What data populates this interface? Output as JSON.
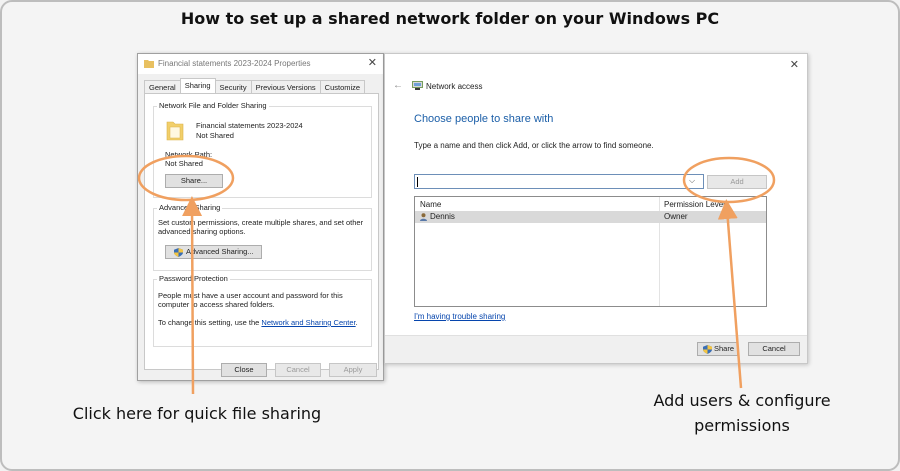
{
  "title": "How to set up a shared network folder on your Windows PC",
  "colors": {
    "accent_orange": "#f0a060",
    "link_blue": "#0645ad",
    "heading_blue": "#1c5fa8"
  },
  "properties_dialog": {
    "window_title": "Financial statements 2023-2024 Properties",
    "tabs": [
      "General",
      "Sharing",
      "Security",
      "Previous Versions",
      "Customize"
    ],
    "active_tab": "Sharing",
    "network_group_label": "Network File and Folder Sharing",
    "folder_name": "Financial statements 2023-2024",
    "folder_status": "Not Shared",
    "network_path_label": "Network Path:",
    "network_path_value": "Not Shared",
    "share_button": "Share...",
    "advanced_group_label": "Advanced Sharing",
    "advanced_desc_line1": "Set custom permissions, create multiple shares, and set other",
    "advanced_desc_line2": "advanced sharing options.",
    "advanced_button": "Advanced Sharing...",
    "password_group_label": "Password Protection",
    "password_desc_line1": "People must have a user account and password for this",
    "password_desc_line2": "computer to access shared folders.",
    "password_change_text": "To change this setting, use the",
    "password_link": "Network and Sharing Center",
    "password_suffix": ".",
    "close_button": "Close",
    "cancel_button": "Cancel",
    "apply_button": "Apply"
  },
  "network_dialog": {
    "window_title": "Network access",
    "heading": "Choose people to share with",
    "instruction": "Type a name and then click Add, or click the arrow to find someone.",
    "input_value": "",
    "add_button": "Add",
    "col_name": "Name",
    "col_permission": "Permission Level",
    "rows": [
      {
        "name": "Dennis",
        "permission": "Owner"
      }
    ],
    "trouble_link": "I'm having trouble sharing",
    "share_button": "Share",
    "cancel_button": "Cancel"
  },
  "annotations": {
    "left_caption": "Click here for quick file sharing",
    "right_caption_line1": "Add users & configure",
    "right_caption_line2": "permissions"
  }
}
